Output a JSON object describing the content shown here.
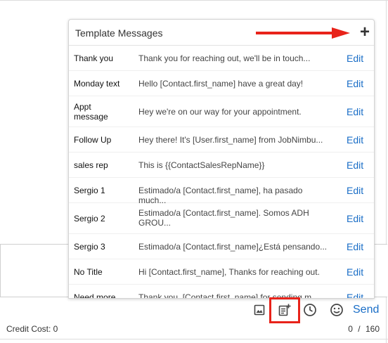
{
  "popover": {
    "title": "Template Messages",
    "add_label": "+",
    "rows": [
      {
        "name": "Thank you",
        "text": "Thank you for reaching out, we'll be in touch...",
        "edit": "Edit"
      },
      {
        "name": "Monday text",
        "text": "Hello [Contact.first_name] have a great day!",
        "edit": "Edit"
      },
      {
        "name": "Appt message",
        "text": "Hey we're on our way for your appointment.",
        "edit": "Edit"
      },
      {
        "name": "Follow Up",
        "text": "Hey there! It's [User.first_name] from JobNimbu...",
        "edit": "Edit"
      },
      {
        "name": "sales rep",
        "text": "This is {{ContactSalesRepName}}",
        "edit": "Edit"
      },
      {
        "name": "Sergio 1",
        "text": "Estimado/a [Contact.first_name], ha pasado much...",
        "edit": "Edit"
      },
      {
        "name": "Sergio 2",
        "text": "Estimado/a [Contact.first_name]. Somos ADH GROU...",
        "edit": "Edit"
      },
      {
        "name": "Sergio 3",
        "text": "Estimado/a [Contact.first_name]¿Está pensando...",
        "edit": "Edit"
      },
      {
        "name": "No Title",
        "text": "Hi [Contact.first_name], Thanks for reaching out.",
        "edit": "Edit"
      },
      {
        "name": "Need more",
        "text": "Thank you, [Contact.first_name] for sending m...",
        "edit": "Edit"
      }
    ]
  },
  "toolbar": {
    "icons": [
      "image-icon",
      "template-icon",
      "clock-icon",
      "emoji-icon"
    ],
    "send_label": "Send"
  },
  "footer": {
    "credit_cost": "Credit Cost: 0",
    "char_count": "0 / 160"
  },
  "colors": {
    "accent": "#1a6ec7",
    "highlight": "#e8231a"
  }
}
